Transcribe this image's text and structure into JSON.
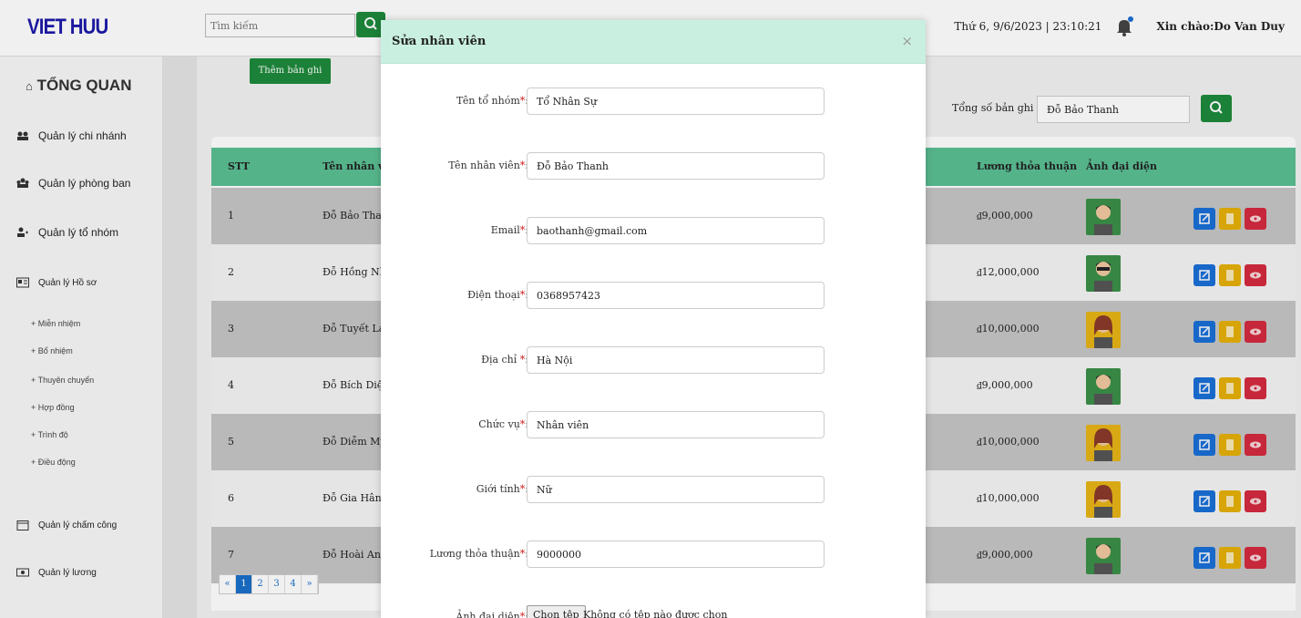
{
  "header": {
    "logo": "VIET HUU",
    "search_placeholder": "Tìm kiếm",
    "datetime": "Thứ 6, 9/6/2023 | 23:10:21",
    "greeting": "Xin chào:Do Van Duy"
  },
  "sidebar": {
    "title": "TỔNG QUAN",
    "items": [
      {
        "label": "Quản lý chi nhánh",
        "icon": "branch-icon"
      },
      {
        "label": "Quản lý phòng ban",
        "icon": "department-icon"
      },
      {
        "label": "Quản lý tổ nhóm",
        "icon": "group-icon"
      },
      {
        "label": "Quản lý Hồ sơ",
        "icon": "profile-card-icon"
      },
      {
        "label": "Quản lý chấm công",
        "icon": "calendar-icon"
      },
      {
        "label": "Quản lý lương",
        "icon": "money-icon"
      }
    ],
    "subitems": [
      "+ Miễn nhiệm",
      "+ Bổ nhiệm",
      "+ Thuyên chuyển",
      "+ Hợp đồng",
      "+ Trình độ",
      "+ Điều động"
    ]
  },
  "main": {
    "add_button": "Thêm bản ghi",
    "total_label": "Tổng số bản ghi",
    "total_search_value": "Đỗ Bảo Thanh",
    "columns": [
      "STT",
      "Tên nhân vi",
      "Lương thỏa thuận",
      "Ảnh đại diện"
    ],
    "rows": [
      {
        "stt": "1",
        "name": "Đỗ Bảo Thai",
        "salary": "₫9,000,000",
        "avatar": "male-beard"
      },
      {
        "stt": "2",
        "name": "Đỗ Hồng Nh",
        "salary": "₫12,000,000",
        "avatar": "male-glasses"
      },
      {
        "stt": "3",
        "name": "Đỗ Tuyết La",
        "salary": "₫10,000,000",
        "avatar": "female"
      },
      {
        "stt": "4",
        "name": "Đỗ Bích Diệ",
        "salary": "₫9,000,000",
        "avatar": "male-beard"
      },
      {
        "stt": "5",
        "name": "Đỗ Diễm My",
        "salary": "₫10,000,000",
        "avatar": "female"
      },
      {
        "stt": "6",
        "name": "Đỗ Gia Hân",
        "salary": "₫10,000,000",
        "avatar": "female"
      },
      {
        "stt": "7",
        "name": "Đỗ Hoài An",
        "salary": "₫9,000,000",
        "avatar": "male-beard"
      }
    ],
    "pagination": [
      "«",
      "1",
      "2",
      "3",
      "4",
      "»"
    ],
    "colors": {
      "edit": "#1a6fd6",
      "detail": "#e5b008",
      "delete": "#d42a3e",
      "header": "#5bbf93",
      "primary": "#1e8a3c"
    }
  },
  "modal": {
    "title": "Sửa nhân viên",
    "close": "×",
    "fields": [
      {
        "label": "Tên tổ nhóm",
        "value": "Tổ Nhân Sự"
      },
      {
        "label": "Tên nhân viên",
        "value": "Đỗ  Bảo Thanh"
      },
      {
        "label": "Email",
        "value": "baothanh@gmail.com"
      },
      {
        "label": "Điện thoại",
        "value": "0368957423"
      },
      {
        "label": "Địa chỉ ",
        "value": "Hà Nội"
      },
      {
        "label": "Chức vụ",
        "value": "Nhân viên"
      },
      {
        "label": "Giới tính",
        "value": "Nữ"
      },
      {
        "label": "Lương thỏa thuận",
        "value": "9000000"
      }
    ],
    "file_field": {
      "label": "Ảnh đại diện",
      "button": "Chọn tệp",
      "status": "Không có tệp nào được chọn"
    }
  }
}
